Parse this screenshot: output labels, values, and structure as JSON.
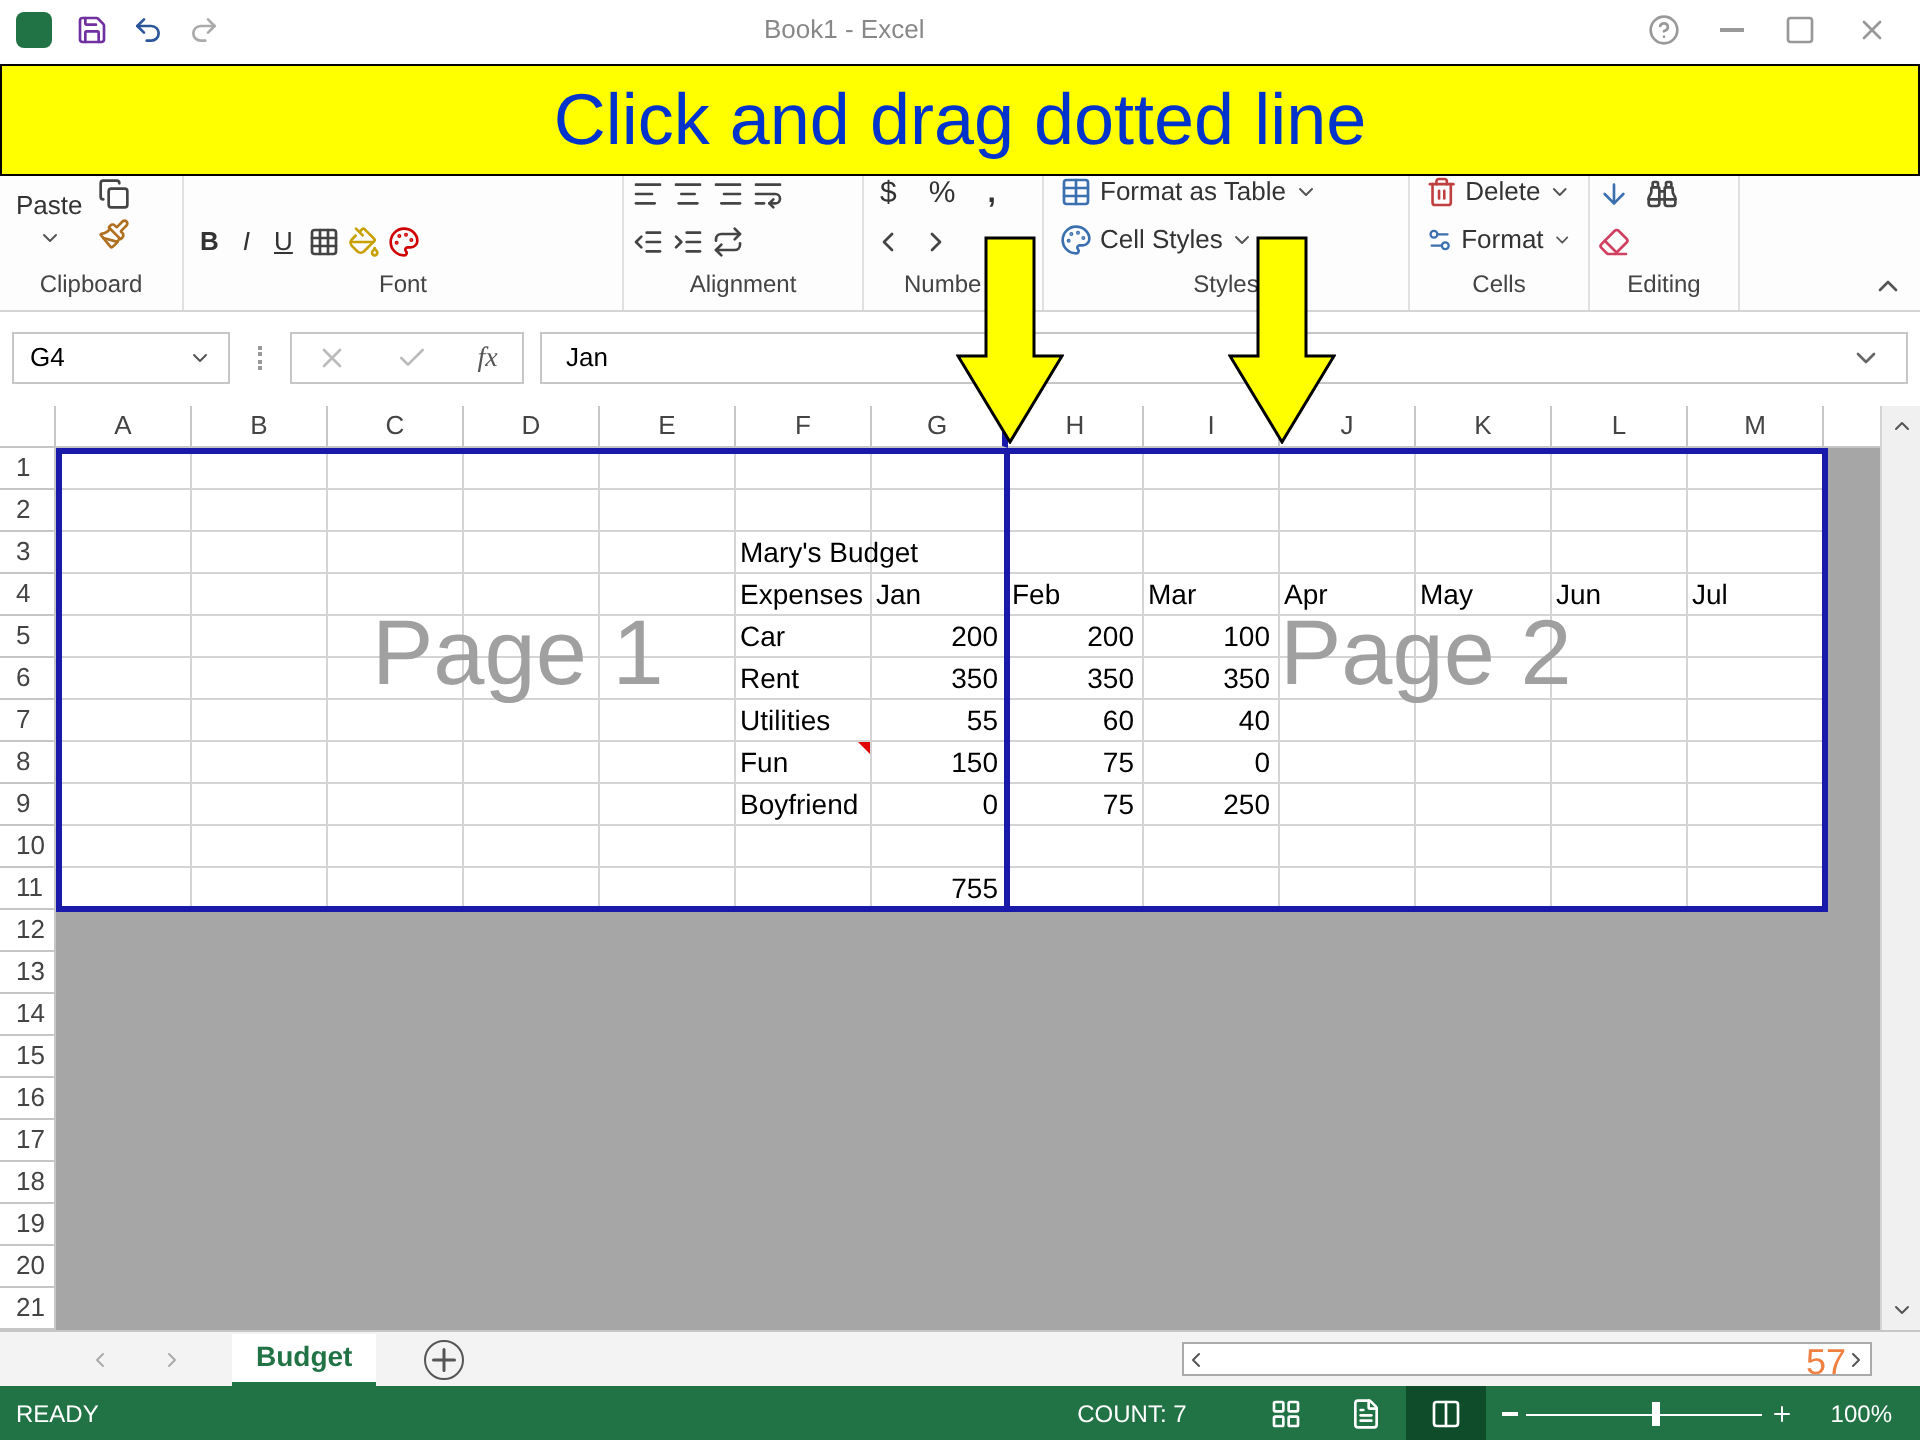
{
  "window": {
    "title": "Book1 - Excel"
  },
  "banner": {
    "text": "Click and drag dotted line"
  },
  "ribbon": {
    "groups": [
      {
        "kind": "clipboard",
        "label": "Clipboard",
        "buttons": [
          "Paste"
        ]
      },
      {
        "kind": "font",
        "label": "Font",
        "buttons": [
          "B",
          "I",
          "U"
        ]
      },
      {
        "kind": "alignment",
        "label": "Alignment"
      },
      {
        "kind": "number",
        "label": "Numbe",
        "buttons": [
          "$",
          "%",
          ","
        ]
      },
      {
        "kind": "styles",
        "label": "Styles",
        "buttons": [
          "Format as Table",
          "Cell Styles"
        ]
      },
      {
        "kind": "cells",
        "label": "Cells",
        "buttons": [
          "Delete",
          "Format"
        ]
      },
      {
        "kind": "editing",
        "label": "Editing"
      }
    ]
  },
  "formula_bar": {
    "name_box": "G4",
    "fx": "fx",
    "value": "Jan"
  },
  "sheet": {
    "columns": [
      {
        "label": "A",
        "page_break_after": false
      },
      {
        "label": "B",
        "page_break_after": false
      },
      {
        "label": "C",
        "page_break_after": false
      },
      {
        "label": "D",
        "page_break_after": false
      },
      {
        "label": "E",
        "page_break_after": false
      },
      {
        "label": "F",
        "page_break_after": false
      },
      {
        "label": "G",
        "page_break_after": true
      },
      {
        "label": "H",
        "page_break_after": false
      },
      {
        "label": "I",
        "page_break_after": false
      },
      {
        "label": "J",
        "page_break_after": false
      },
      {
        "label": "K",
        "page_break_after": false
      },
      {
        "label": "L",
        "page_break_after": false
      },
      {
        "label": "M",
        "page_break_after": false
      }
    ],
    "rows": [
      {
        "header": "1",
        "in_print_area": true,
        "cells": []
      },
      {
        "header": "2",
        "in_print_area": true,
        "cells": []
      },
      {
        "header": "3",
        "in_print_area": true,
        "cells": [
          "",
          "",
          "",
          "",
          "",
          "Mary's Budget"
        ]
      },
      {
        "header": "4",
        "in_print_area": true,
        "cells": [
          "",
          "",
          "",
          "",
          "",
          "Expenses",
          "Jan",
          "Feb",
          "Mar",
          "Apr",
          "May",
          "Jun",
          "Jul"
        ]
      },
      {
        "header": "5",
        "in_print_area": true,
        "cells": [
          "",
          "",
          "",
          "",
          "",
          "Car",
          "200",
          "200",
          "100"
        ]
      },
      {
        "header": "6",
        "in_print_area": true,
        "cells": [
          "",
          "",
          "",
          "",
          "",
          "Rent",
          "350",
          "350",
          "350"
        ]
      },
      {
        "header": "7",
        "in_print_area": true,
        "cells": [
          "",
          "",
          "",
          "",
          "",
          "Utilities",
          "55",
          "60",
          "40"
        ]
      },
      {
        "header": "8",
        "in_print_area": true,
        "cells": [
          "",
          "",
          "",
          "",
          "",
          {
            "text": "Fun",
            "comment": true
          },
          "150",
          "75",
          "0"
        ]
      },
      {
        "header": "9",
        "in_print_area": true,
        "cells": [
          "",
          "",
          "",
          "",
          "",
          "Boyfriend",
          "0",
          "75",
          "250"
        ]
      },
      {
        "header": "10",
        "in_print_area": true,
        "cells": []
      },
      {
        "header": "11",
        "in_print_area": true,
        "cells": [
          "",
          "",
          "",
          "",
          "",
          "",
          "755"
        ]
      },
      {
        "header": "12",
        "in_print_area": false,
        "cells": []
      },
      {
        "header": "13",
        "in_print_area": false,
        "cells": []
      },
      {
        "header": "14",
        "in_print_area": false,
        "cells": []
      },
      {
        "header": "15",
        "in_print_area": false,
        "cells": []
      },
      {
        "header": "16",
        "in_print_area": false,
        "cells": []
      },
      {
        "header": "17",
        "in_print_area": false,
        "cells": []
      },
      {
        "header": "18",
        "in_print_area": false,
        "cells": []
      },
      {
        "header": "19",
        "in_print_area": false,
        "cells": []
      },
      {
        "header": "20",
        "in_print_area": false,
        "cells": []
      },
      {
        "header": "21",
        "in_print_area": false,
        "cells": []
      }
    ],
    "page_labels": [
      "Page 1",
      "Page 2"
    ]
  },
  "sheet_tabs": [
    {
      "label": "Budget",
      "selected": true
    }
  ],
  "slide_number": "57",
  "status_bar": {
    "status": "READY",
    "count": "COUNT: 7",
    "views": [
      {
        "kind": "normal",
        "selected": false
      },
      {
        "kind": "page_layout",
        "selected": false
      },
      {
        "kind": "page_break",
        "selected": true
      }
    ],
    "zoom": {
      "level": 0.55,
      "reading": "100%"
    }
  }
}
